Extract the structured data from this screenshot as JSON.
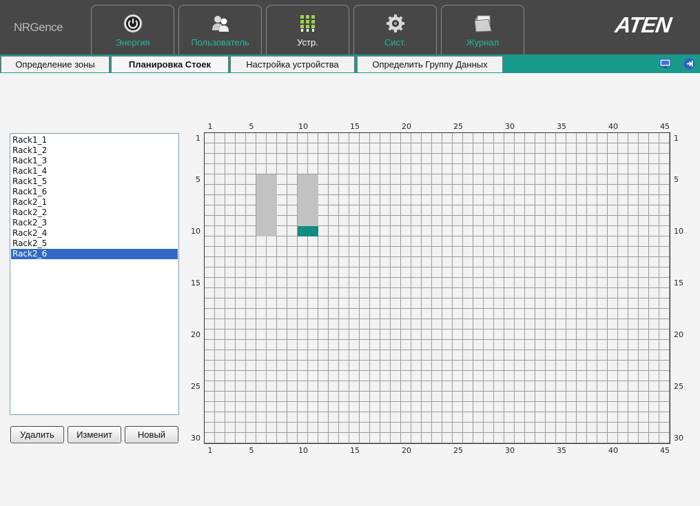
{
  "brand": {
    "product": "NRGence",
    "vendor": "ATEN"
  },
  "top_nav": [
    {
      "label": "Энергия",
      "icon": "power-icon",
      "active": false
    },
    {
      "label": "Пользователь",
      "icon": "users-icon",
      "active": false
    },
    {
      "label": "Устр.",
      "icon": "devices-icon",
      "active": true
    },
    {
      "label": "Сист.",
      "icon": "system-gear-icon",
      "active": false
    },
    {
      "label": "Журнал",
      "icon": "log-folder-icon",
      "active": false
    }
  ],
  "sub_nav": [
    {
      "label": "Определение зоны",
      "active": false
    },
    {
      "label": "Планировка Стоек",
      "active": true
    },
    {
      "label": "Настройка устройства",
      "active": false
    },
    {
      "label": "Определить Группу Данных",
      "active": false
    }
  ],
  "sub_nav_icons": [
    "monitor-icon",
    "logout-icon"
  ],
  "rack_list": {
    "items": [
      "Rack1_1",
      "Rack1_2",
      "Rack1_3",
      "Rack1_4",
      "Rack1_5",
      "Rack1_6",
      "Rack2_1",
      "Rack2_2",
      "Rack2_3",
      "Rack2_4",
      "Rack2_5",
      "Rack2_6"
    ],
    "selected": "Rack2_6"
  },
  "buttons": {
    "delete": "Удалить",
    "modify": "Изменит",
    "new": "Новый"
  },
  "floor_grid": {
    "columns": 45,
    "rows": 30,
    "x_ticks": [
      1,
      5,
      10,
      15,
      20,
      25,
      30,
      35,
      40,
      45
    ],
    "y_ticks": [
      1,
      5,
      10,
      15,
      20,
      25,
      30
    ],
    "cell_color": "#f2f2f2",
    "line_color": "#9a9a9a",
    "racks": [
      {
        "col": 6,
        "row": 5,
        "width": 2,
        "height": 6,
        "color": "#c2c2c2"
      },
      {
        "col": 10,
        "row": 5,
        "width": 2,
        "height": 5,
        "color": "#c2c2c2"
      },
      {
        "col": 10,
        "row": 10,
        "width": 2,
        "height": 1,
        "color": "#138a82"
      }
    ]
  },
  "colors": {
    "header_bg": "#474747",
    "accent": "#1a9a8c",
    "tab_label": "#25b3a4",
    "selection": "#316ac5"
  }
}
